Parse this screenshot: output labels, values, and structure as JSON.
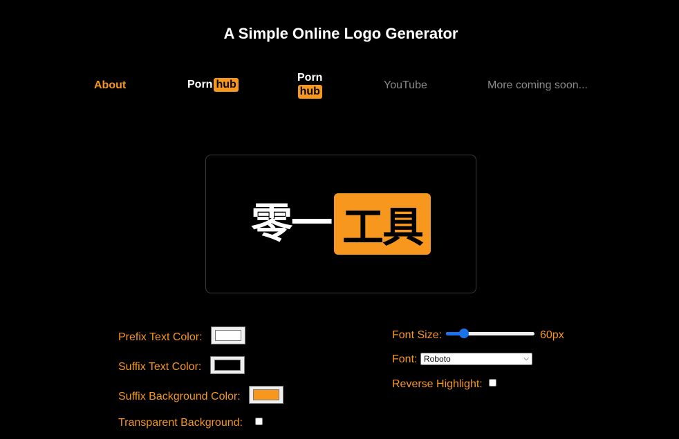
{
  "header": {
    "title": "A Simple Online Logo Generator"
  },
  "nav": {
    "about": "About",
    "pornhub_inline": {
      "prefix": "Porn",
      "suffix": "hub"
    },
    "pornhub_stacked": {
      "prefix": "Porn",
      "suffix": "hub"
    },
    "youtube": "YouTube",
    "more": "More coming soon..."
  },
  "preview": {
    "prefix_text": "零一",
    "suffix_text": "工具"
  },
  "controls": {
    "prefix_color_label": "Prefix Text Color:",
    "prefix_color": "#ffffff",
    "suffix_color_label": "Suffix Text Color:",
    "suffix_color": "#000000",
    "suffix_bg_label": "Suffix Background Color:",
    "suffix_bg": "#f7971d",
    "transparent_bg_label": "Transparent Background:",
    "transparent_bg_checked": false,
    "font_size_label": "Font Size:",
    "font_size_value": "60px",
    "font_size_fraction": 0.2,
    "font_label": "Font:",
    "font_selected": "Roboto",
    "reverse_label": "Reverse Highlight:",
    "reverse_checked": false
  },
  "colors": {
    "accent": "#f7971d",
    "background": "#000000",
    "muted": "#8a8a8a",
    "slider": "#1a73e8"
  }
}
